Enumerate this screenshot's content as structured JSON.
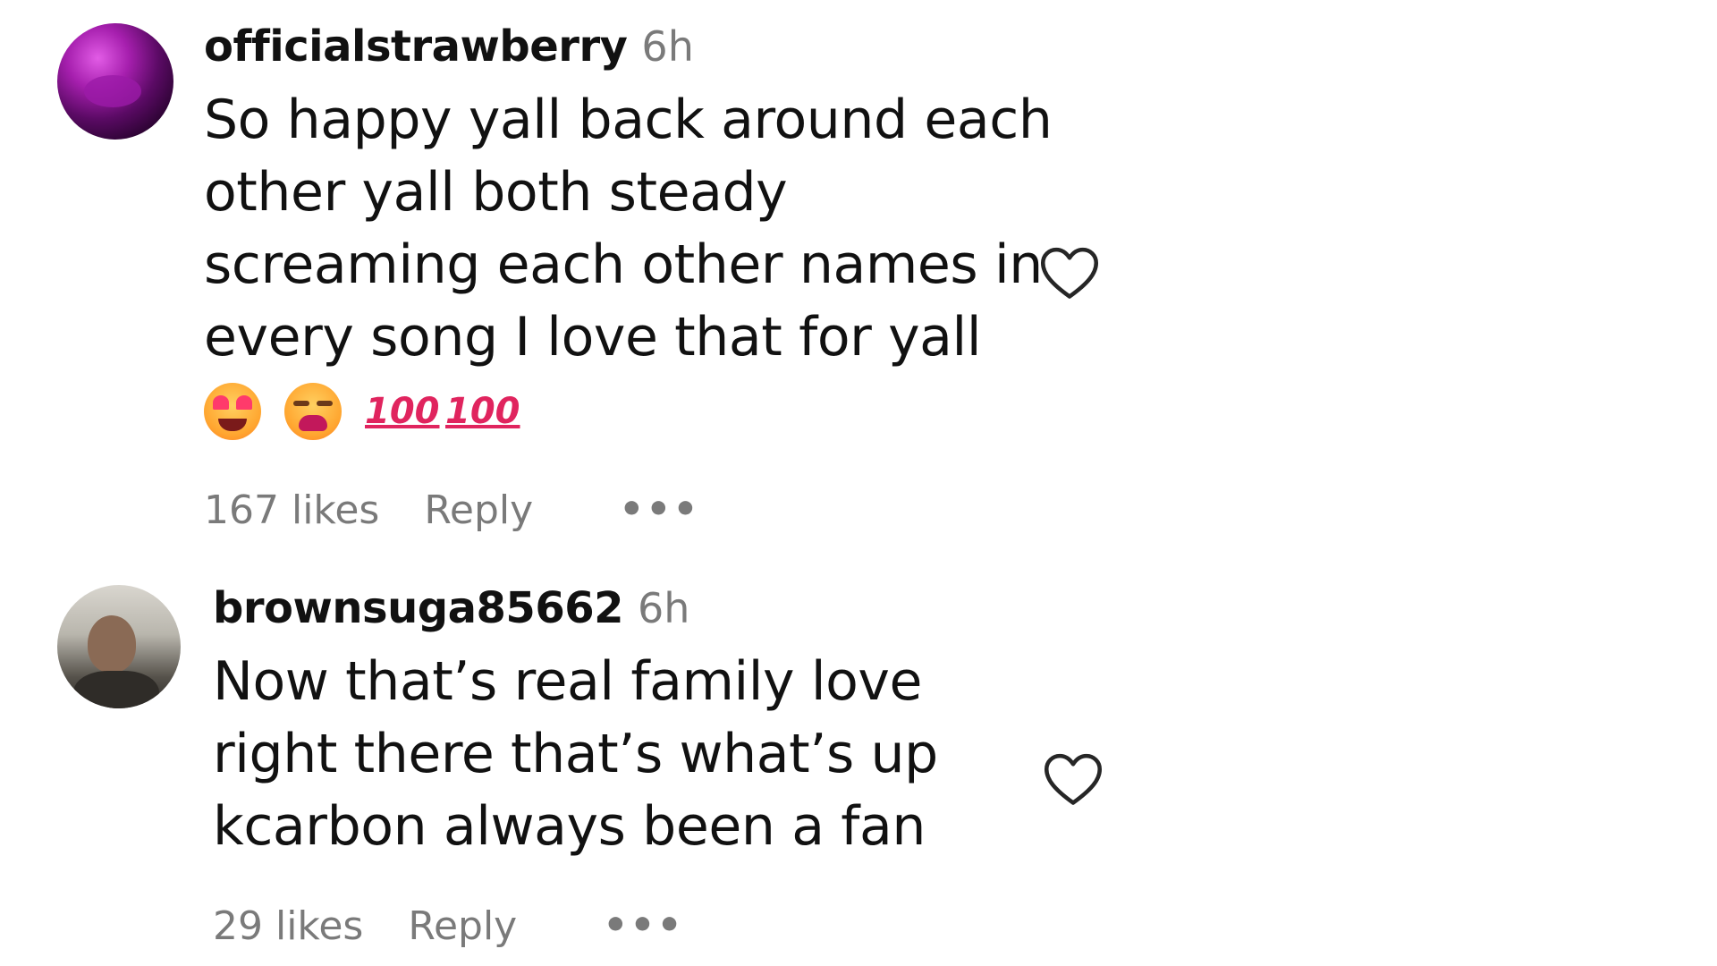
{
  "comments": [
    {
      "username": "officialstrawberry",
      "time": "6h",
      "text_lines": [
        "So happy yall back around each",
        "other yall both steady",
        "screaming each other names in",
        "every song I love that for yall"
      ],
      "emojis": [
        "smiling-face-with-heart-eyes",
        "weary-face",
        "hundred-points",
        "hundred-points"
      ],
      "hundred_label": "100",
      "likes": "167 likes",
      "reply_label": "Reply",
      "more_label": "•••"
    },
    {
      "username": "brownsuga85662",
      "time": "6h",
      "text_lines": [
        "Now that’s real family love",
        "right there that’s what’s up",
        "kcarbon always been a fan"
      ],
      "likes": "29 likes",
      "reply_label": "Reply",
      "more_label": "•••"
    }
  ],
  "icons": {
    "like": "heart-outline-icon",
    "more": "more-options-icon"
  },
  "colors": {
    "text": "#111111",
    "muted": "#7a7a7a",
    "heart_outline": "#262626"
  }
}
